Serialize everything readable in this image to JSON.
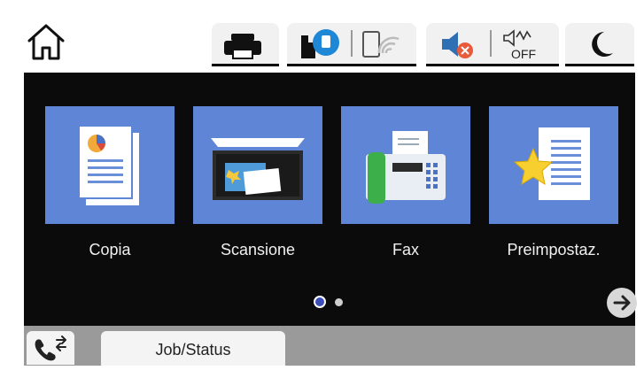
{
  "apps": [
    {
      "label": "Copia"
    },
    {
      "label": "Scansione"
    },
    {
      "label": "Fax"
    },
    {
      "label": "Preimpostaz."
    }
  ],
  "tabs": {
    "job_status": "Job/Status"
  },
  "status_icons": [
    "printer-icon",
    "bluetooth-device-icon",
    "wifi-off-icon",
    "sound-muted-icon",
    "quiet-mode-off-icon",
    "sleep-moon-icon"
  ],
  "pagination": {
    "current": 1,
    "total": 2
  },
  "colors": {
    "tile": "#5f85d7",
    "background": "#0b0b0b",
    "bottom_bar": "#9a9a9a",
    "active_dot": "#3a4db8"
  }
}
